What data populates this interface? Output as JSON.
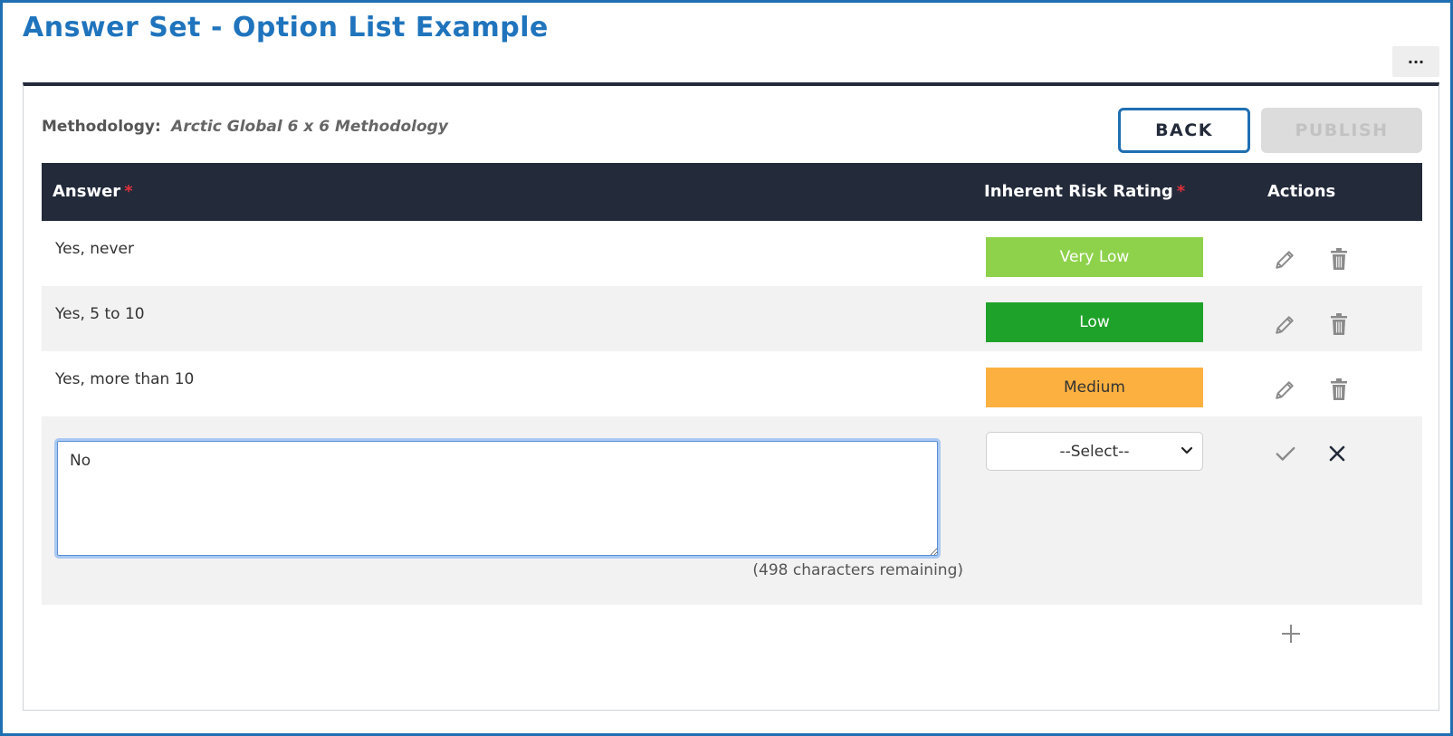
{
  "page": {
    "title": "Answer Set - Option List Example",
    "more_label": "···"
  },
  "methodology": {
    "label": "Methodology:",
    "value": "Arctic Global 6 x 6 Methodology"
  },
  "buttons": {
    "back": "BACK",
    "publish": "PUBLISH"
  },
  "table": {
    "headers": {
      "answer": "Answer",
      "rating": "Inherent Risk Rating",
      "actions": "Actions",
      "required_marker": "*"
    },
    "rows": [
      {
        "answer": "Yes, never",
        "rating": "Very Low",
        "rating_color": "#8ed24b",
        "rating_text_color": "#ffffff"
      },
      {
        "answer": "Yes, 5 to 10",
        "rating": "Low",
        "rating_color": "#1fa22a",
        "rating_text_color": "#ffffff"
      },
      {
        "answer": "Yes, more than 10",
        "rating": "Medium",
        "rating_color": "#fbb040",
        "rating_text_color": "#333333"
      }
    ],
    "edit_row": {
      "answer_value": "No",
      "chars_remaining": "(498 characters remaining)",
      "select_value": "--Select--"
    }
  },
  "icons": {
    "edit": "pencil-icon",
    "delete": "trash-icon",
    "confirm": "check-icon",
    "cancel": "close-icon",
    "add": "plus-icon",
    "more": "ellipsis-icon"
  },
  "colors": {
    "title": "#1f74bd",
    "header_bg": "#232a3a",
    "accent": "#1f6fb2",
    "required": "#e0303a"
  }
}
